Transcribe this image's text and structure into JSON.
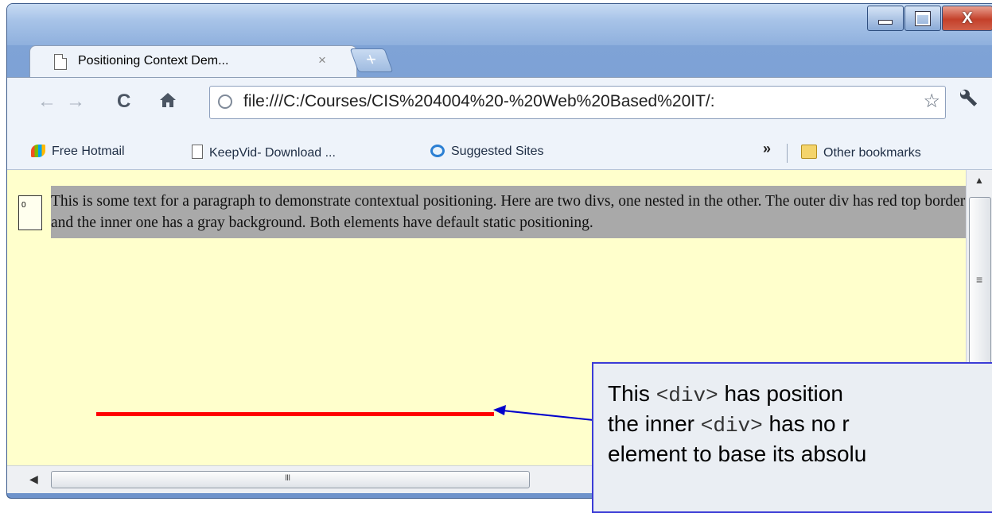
{
  "window": {
    "controls": {
      "minimize": "",
      "maximize": "",
      "close": "X"
    }
  },
  "tab": {
    "title": "Positioning Context Dem...",
    "close": "×",
    "new_tab": "+"
  },
  "toolbar": {
    "back": "←",
    "forward": "→",
    "reload": "C",
    "home": "🏠",
    "url": "file:///C:/Courses/CIS%204004%20-%20Web%20Based%20IT/:",
    "star": "☆",
    "wrench": "🔧"
  },
  "bookmarks": {
    "items": [
      {
        "label": "Free Hotmail",
        "icon": "msn-icon"
      },
      {
        "label": "KeepVid- Download ...",
        "icon": "page-icon"
      },
      {
        "label": "Suggested Sites",
        "icon": "ie-icon"
      }
    ],
    "overflow": "»",
    "other": "Other bookmarks"
  },
  "content": {
    "paragraph": "This is some text for a paragraph to demonstrate contextual positioning. Here are two divs, one nested in the other. The outer div has red top border and the inner one has a gray background. Both elements have default static positioning.",
    "tiny_box": "0"
  },
  "callout": {
    "line1_a": "This ",
    "line1_code": "<div>",
    "line1_b": "  has position",
    "line2_a": "the inner ",
    "line2_code": "<div>",
    "line2_b": "  has no r",
    "line3": "element to base its absolu"
  },
  "colors": {
    "content_bg": "#ffffcc",
    "paragraph_bg": "#a9a9a9",
    "red_line": "#ff0000",
    "callout_border": "#3b3bd6"
  }
}
